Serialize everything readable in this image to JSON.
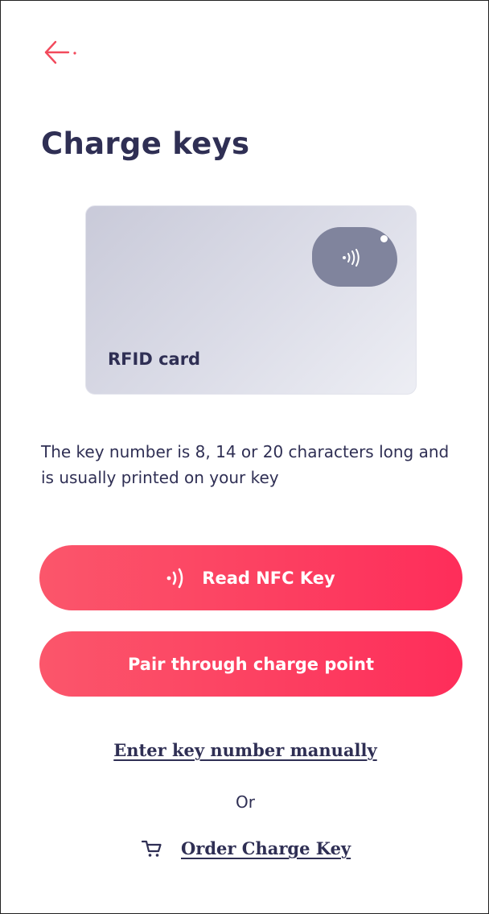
{
  "header": {
    "back_icon": "arrow-left-icon",
    "title": "Charge keys"
  },
  "card": {
    "label": "RFID card",
    "chip_icon": "nfc-signal-icon"
  },
  "description": "The key number is 8, 14 or 20 characters long and is usually printed on your key",
  "actions": {
    "read_nfc_label": "Read NFC Key",
    "read_nfc_icon": "nfc-signal-icon",
    "pair_label": "Pair through charge point",
    "manual_label": "Enter key number manually",
    "or_label": "Or",
    "order_label": "Order Charge Key",
    "order_icon": "cart-icon"
  },
  "colors": {
    "accent": "#fc4262",
    "text": "#2f2f54",
    "card_chip": "#80849d"
  }
}
